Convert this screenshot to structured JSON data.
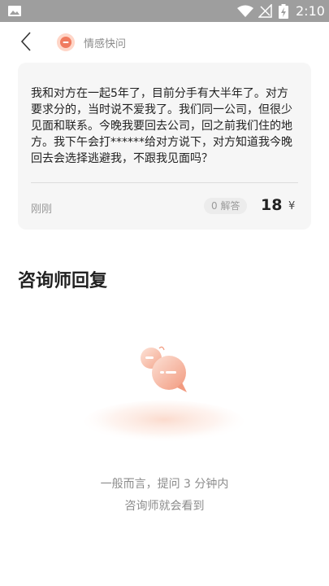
{
  "statusbar": {
    "time": "2:10"
  },
  "header": {
    "title": "情感快问"
  },
  "question": {
    "text": "我和对方在一起5年了，目前分手有大半年了。对方要求分的，当时说不爱我了。我们同一公司，但很少见面和联系。今晚我要回去公司，回之前我们住的地方。我下午会打******给对方说下，对方知道我今晚回去会选择逃避我，不跟我见面吗？",
    "time_label": "刚刚",
    "answers_badge": "0 解答",
    "price": "18",
    "currency": "¥"
  },
  "replies": {
    "section_title": "咨询师回复",
    "empty_line1": "一般而言，提问 3 分钟内",
    "empty_line2": "咨询师就会看到"
  },
  "colors": {
    "accent": "#f07b5f",
    "card_bg": "#f6f6f6"
  }
}
